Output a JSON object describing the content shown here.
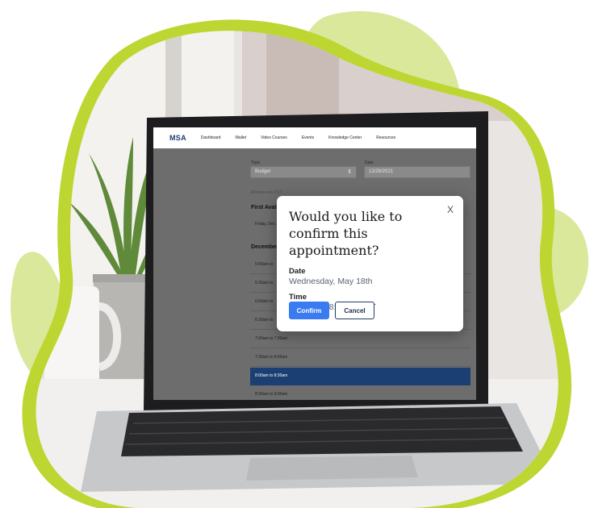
{
  "app": {
    "logo": "MSA",
    "nav": [
      "Dashboard",
      "Wallet",
      "Video Courses",
      "Events",
      "Knowledge Center",
      "Resources"
    ]
  },
  "form": {
    "topic_label": "Topic",
    "topic_value": "Budget",
    "date_label": "Date",
    "date_value": "12/29/2021",
    "timezone_note": "All times are PST",
    "first_available": "First Availa",
    "first_slot": "Friday, Dec",
    "december_head": "December",
    "slots": [
      "5:00am to",
      "5:30am to",
      "6:00am to",
      "6:30am to",
      "7:00am to 7:30am",
      "7:30am to 8:00am",
      "8:00am to 8:30am",
      "8:30am to 9:00am"
    ]
  },
  "modal": {
    "title": "Would you like to confirm this appointment?",
    "close": "X",
    "date_label": "Date",
    "date_value": "Wednesday, May 18th",
    "time_label": "Time",
    "time_value": "8:00am to 8:30am PST",
    "confirm": "Confirm",
    "cancel": "Cancel"
  },
  "colors": {
    "accent_green": "#bdd631",
    "light_green": "#d9e89a",
    "confirm_blue": "#3a7bf1",
    "selected_slot": "#1b3f72"
  }
}
